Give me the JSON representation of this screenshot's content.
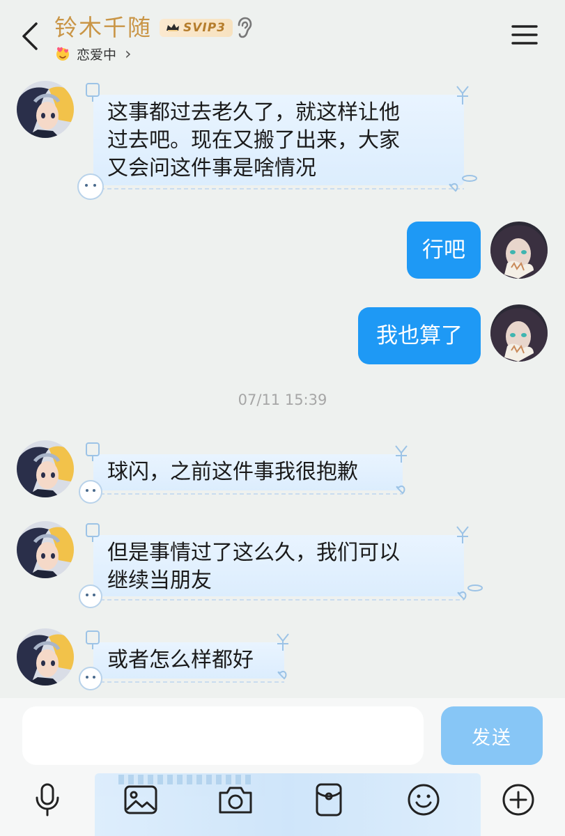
{
  "header": {
    "title": "铃木千随",
    "svip_label": "SVIP3",
    "status_text": "恋爱中",
    "status_chevron": "›"
  },
  "messages": [
    {
      "side": "incoming",
      "text_lines": [
        "这事都过去老久了，就这样让他",
        "过去吧。现在又搬了出来，大家",
        "又会问这件事是啥情况"
      ]
    },
    {
      "side": "outgoing",
      "text": "行吧"
    },
    {
      "side": "outgoing",
      "text": "我也算了"
    },
    {
      "side": "incoming",
      "text_lines": [
        "球闪，之前这件事我很抱歉"
      ]
    },
    {
      "side": "incoming",
      "text_lines": [
        "但是事情过了这么久，我们可以",
        "继续当朋友"
      ]
    },
    {
      "side": "incoming",
      "text_lines": [
        "或者怎么样都好"
      ]
    }
  ],
  "timestamp": "07/11 15:39",
  "input": {
    "value": "",
    "placeholder": "",
    "send_label": "发送"
  },
  "toolbar": {
    "icons": [
      "microphone-icon",
      "image-icon",
      "camera-icon",
      "red-packet-icon",
      "emoji-icon",
      "plus-icon"
    ]
  },
  "colors": {
    "title": "#c99546",
    "outgoing_bubble": "#1e99f5",
    "incoming_bubble": "#e3f0fd",
    "send_button": "#87c6f6",
    "background": "#eef1ef"
  }
}
